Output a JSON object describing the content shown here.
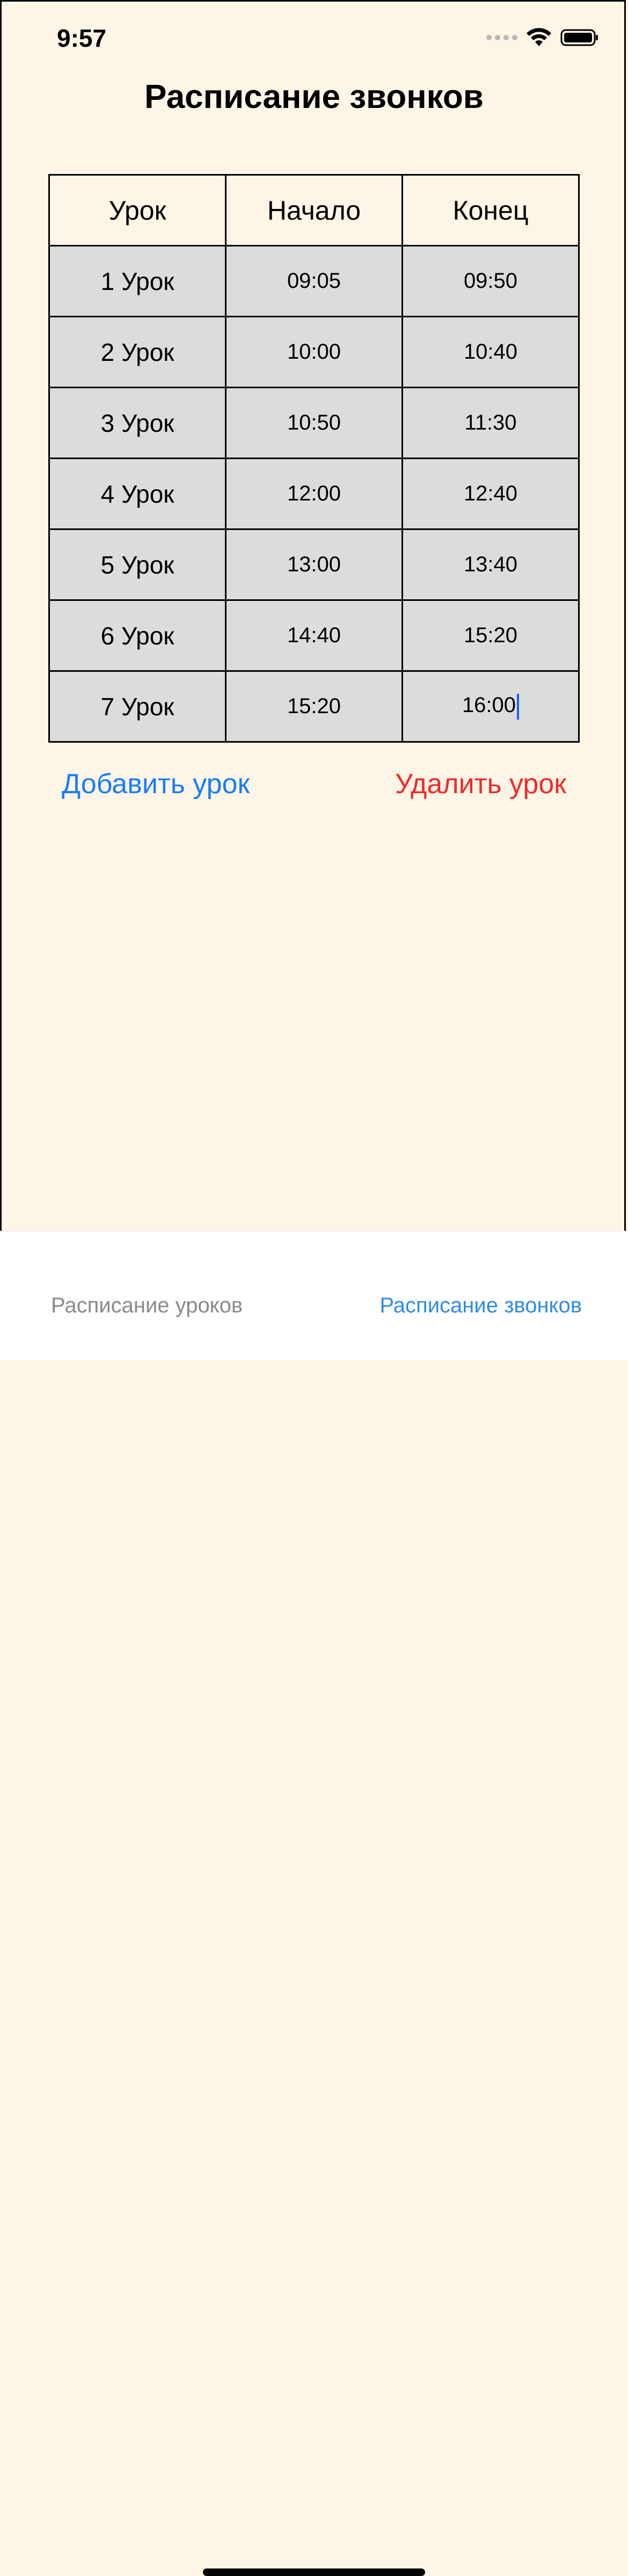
{
  "status_bar": {
    "time": "9:57"
  },
  "page": {
    "title": "Расписание звонков"
  },
  "table": {
    "headers": [
      "Урок",
      "Начало",
      "Конец"
    ],
    "rows": [
      {
        "lesson": "1 Урок",
        "start": "09:05",
        "end": "09:50"
      },
      {
        "lesson": "2 Урок",
        "start": "10:00",
        "end": "10:40"
      },
      {
        "lesson": "3 Урок",
        "start": "10:50",
        "end": "11:30"
      },
      {
        "lesson": "4 Урок",
        "start": "12:00",
        "end": "12:40"
      },
      {
        "lesson": "5 Урок",
        "start": "13:00",
        "end": "13:40"
      },
      {
        "lesson": "6 Урок",
        "start": "14:40",
        "end": "15:20"
      },
      {
        "lesson": "7 Урок",
        "start": "15:20",
        "end": "16:00"
      }
    ]
  },
  "actions": {
    "add_label": "Добавить урок",
    "delete_label": "Удалить урок"
  },
  "tab_bar": {
    "tabs": [
      {
        "label": "Расписание уроков",
        "active": false
      },
      {
        "label": "Расписание звонков",
        "active": true
      }
    ]
  },
  "colors": {
    "background": "#fdf5e6",
    "row_fill": "#dcdcdc",
    "add_blue": "#1a7cf5",
    "delete_red": "#f02a2a",
    "tab_active": "#2f8be6",
    "tab_inactive": "#8a8a8a"
  },
  "icons": [
    "signal-icon",
    "wifi-icon",
    "battery-icon"
  ]
}
